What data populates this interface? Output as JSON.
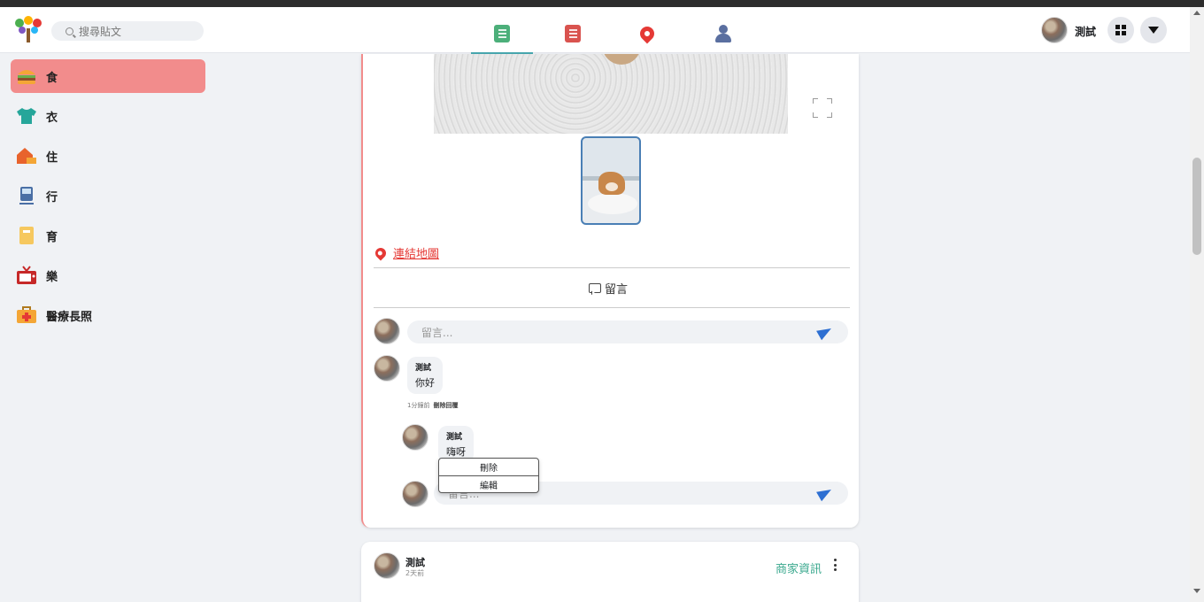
{
  "header": {
    "search_placeholder": "搜尋貼文",
    "user_name": "測試"
  },
  "nav_tabs": [
    {
      "name": "posts-tab",
      "color": "#4caf7a"
    },
    {
      "name": "list-tab",
      "color": "#d9534f"
    },
    {
      "name": "map-tab",
      "color": "#e53935"
    },
    {
      "name": "friends-tab",
      "color": "#5a6fa0"
    }
  ],
  "sidebar": {
    "items": [
      {
        "label": "食",
        "icon": "burger-icon"
      },
      {
        "label": "衣",
        "icon": "shirt-icon"
      },
      {
        "label": "住",
        "icon": "house-icon"
      },
      {
        "label": "行",
        "icon": "train-icon"
      },
      {
        "label": "育",
        "icon": "notebook-icon"
      },
      {
        "label": "樂",
        "icon": "tv-icon"
      },
      {
        "label": "醫療長照",
        "icon": "medkit-icon"
      }
    ]
  },
  "post": {
    "map_link": "連結地圖",
    "comment_button": "留言",
    "comment_placeholder": "留言...",
    "comments": [
      {
        "author": "測試",
        "text": "你好",
        "time": "1分鐘前",
        "reply_label": "刪除回覆"
      },
      {
        "author": "測試",
        "text": "嗨呀"
      }
    ],
    "reply_placeholder": "留言...",
    "context_menu": {
      "delete": "刪除",
      "edit": "編輯"
    }
  },
  "next_post": {
    "author": "測試",
    "time": "2天前",
    "shop_info": "商家資訊"
  },
  "colors": {
    "accent": "#f28c8c",
    "active_tab_underline": "#48a8b0",
    "link_red": "#e53935",
    "send_blue": "#2d6fd2",
    "shop_green": "#3aa88e"
  }
}
